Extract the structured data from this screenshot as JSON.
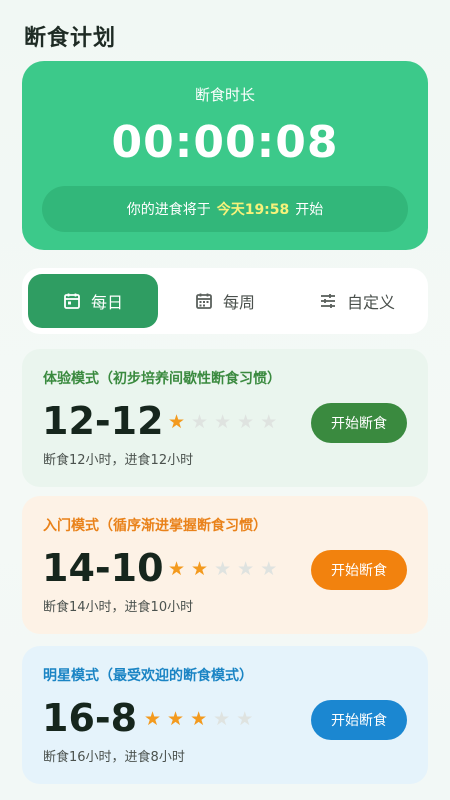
{
  "page": {
    "title": "断食计划"
  },
  "timer": {
    "label": "断食时长",
    "value": "00:00:08",
    "note_prefix": "你的进食将于",
    "note_time": "今天19:58",
    "note_suffix": "开始"
  },
  "tabs": [
    {
      "label": "每日",
      "icon": "calendar-day-icon",
      "active": true
    },
    {
      "label": "每周",
      "icon": "calendar-week-icon",
      "active": false
    },
    {
      "label": "自定义",
      "icon": "sliders-icon",
      "active": false
    }
  ],
  "modes": [
    {
      "name": "体验模式（初步培养间歇性断食习惯）",
      "ratio": "12-12",
      "stars": 1,
      "max_stars": 5,
      "desc": "断食12小时，进食12小时",
      "button": "开始断食",
      "accent": "#3a8a3f",
      "bg": "#eaf5ee",
      "button_color": "#3a8a3f"
    },
    {
      "name": "入门模式（循序渐进掌握断食习惯）",
      "ratio": "14-10",
      "stars": 2,
      "max_stars": 5,
      "desc": "断食14小时，进食10小时",
      "button": "开始断食",
      "accent": "#e9821a",
      "bg": "#fdf2e6",
      "button_color": "#f2820e"
    },
    {
      "name": "明星模式（最受欢迎的断食模式）",
      "ratio": "16-8",
      "stars": 3,
      "max_stars": 5,
      "desc": "断食16小时，进食8小时",
      "button": "开始断食",
      "accent": "#1a84c4",
      "bg": "#e5f3fb",
      "button_color": "#1b87d1"
    }
  ]
}
